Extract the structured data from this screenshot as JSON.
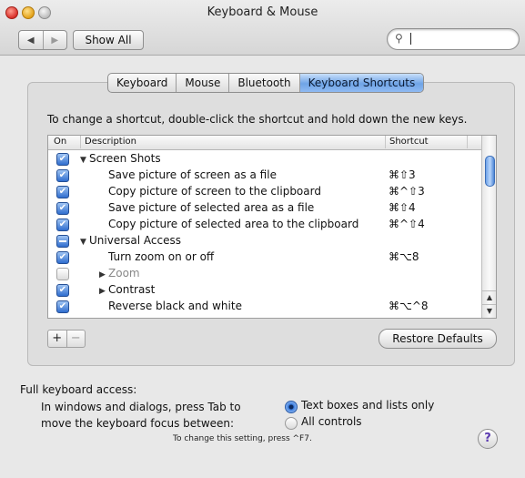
{
  "window": {
    "title": "Keyboard & Mouse",
    "show_all_label": "Show All",
    "search_value": "",
    "nav_back": "◀",
    "nav_forward": "▶"
  },
  "tabs": [
    {
      "label": "Keyboard",
      "active": false
    },
    {
      "label": "Mouse",
      "active": false
    },
    {
      "label": "Bluetooth",
      "active": false
    },
    {
      "label": "Keyboard Shortcuts",
      "active": true
    }
  ],
  "instructions": "To change a shortcut, double-click the shortcut and hold down the new keys.",
  "table": {
    "headers": {
      "on": "On",
      "description": "Description",
      "shortcut": "Shortcut"
    },
    "rows": [
      {
        "state": "checked",
        "level": 0,
        "disclosure": "▼",
        "description": "Screen Shots",
        "shortcut": ""
      },
      {
        "state": "checked",
        "level": 1,
        "disclosure": "",
        "description": "Save picture of screen as a file",
        "shortcut": "⌘⇧3"
      },
      {
        "state": "checked",
        "level": 1,
        "disclosure": "",
        "description": "Copy picture of screen to the clipboard",
        "shortcut": "⌘^⇧3"
      },
      {
        "state": "checked",
        "level": 1,
        "disclosure": "",
        "description": "Save picture of selected area as a file",
        "shortcut": "⌘⇧4"
      },
      {
        "state": "checked",
        "level": 1,
        "disclosure": "",
        "description": "Copy picture of selected area to the clipboard",
        "shortcut": "⌘^⇧4"
      },
      {
        "state": "mixed",
        "level": 0,
        "disclosure": "▼",
        "description": "Universal Access",
        "shortcut": ""
      },
      {
        "state": "checked",
        "level": 1,
        "disclosure": "",
        "description": "Turn zoom on or off",
        "shortcut": "⌘⌥8"
      },
      {
        "state": "unchecked",
        "level": 2,
        "disclosure": "▶",
        "description": "Zoom",
        "shortcut": "",
        "dim": true
      },
      {
        "state": "checked",
        "level": 2,
        "disclosure": "▶",
        "description": "Contrast",
        "shortcut": ""
      },
      {
        "state": "checked",
        "level": 1,
        "disclosure": "",
        "description": "Reverse black and white",
        "shortcut": "⌘⌥^8"
      }
    ]
  },
  "buttons": {
    "add": "+",
    "remove": "−",
    "restore_defaults": "Restore Defaults"
  },
  "full_keyboard_access": {
    "title": "Full keyboard access:",
    "line1": "In windows and dialogs, press Tab to",
    "line2": "move the keyboard focus between:",
    "options": [
      {
        "label": "Text boxes and lists only",
        "selected": true
      },
      {
        "label": "All controls",
        "selected": false
      }
    ],
    "hint": "To change this setting, press ^F7."
  },
  "colors": {
    "accent": "#3c7ee0",
    "window_bg": "#e8e8e8"
  }
}
